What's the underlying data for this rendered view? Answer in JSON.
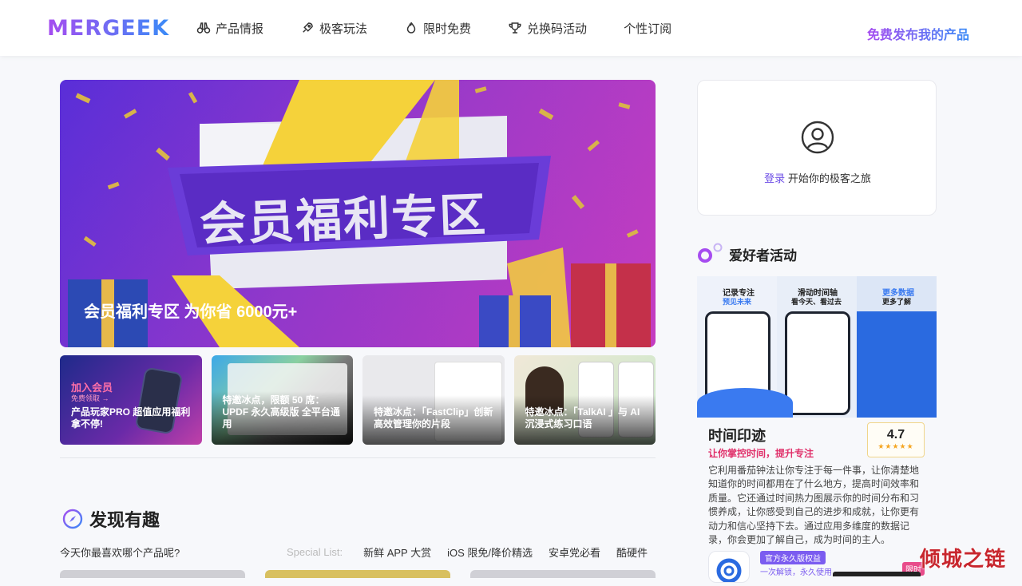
{
  "header": {
    "logo": "MERGEEK",
    "nav": [
      {
        "label": "产品情报",
        "icon": "binoculars-icon"
      },
      {
        "label": "极客玩法",
        "icon": "rocket-icon"
      },
      {
        "label": "限时免费",
        "icon": "flame-icon"
      },
      {
        "label": "兑换码活动",
        "icon": "trophy-icon"
      },
      {
        "label": "个性订阅",
        "icon": ""
      }
    ],
    "publish_label": "免费发布我的产品"
  },
  "hero": {
    "banner_text": "会员福利专区",
    "caption": "会员福利专区 为你省 6000元+"
  },
  "cards": [
    {
      "badge": "加入会员",
      "badge_sub": "免费领取 →",
      "text": "产品玩家PRO 超值应用福利拿不停!"
    },
    {
      "badge": "",
      "badge_sub": "",
      "text": "特邀冰点，限额 50 席：UPDF 永久高级版 全平台通用"
    },
    {
      "badge": "",
      "badge_sub": "",
      "text": "特邀冰点：「FastClip」创新高效管理你的片段"
    },
    {
      "badge": "",
      "badge_sub": "",
      "text": "特邀冰点：「TalkAI 」与 AI 沉浸式练习口语"
    }
  ],
  "discover": {
    "title": "发现有趣",
    "question": "今天你最喜欢哪个产品呢?",
    "special_label": "Special List:",
    "special_links": [
      "新鲜 APP 大赏",
      "iOS 限免/降价精选",
      "安卓党必看",
      "酷硬件"
    ]
  },
  "login": {
    "login_link": "登录",
    "text": "开始你的极客之旅"
  },
  "activity": {
    "title": "爱好者活动",
    "app_name": "时间印迹",
    "slogan": "让你掌控时间，提升专注",
    "rating": "4.7",
    "stars": "★★★★★",
    "description": "它利用番茄钟法让你专注于每一件事，让你清楚地知道你的时间都用在了什么地方，提高时间效率和质量。它还通过时间热力图展示你的时间分布和习惯养成，让你感受到自己的进步和成就，让你更有动力和信心坚持下去。通过应用多维度的数据记录，你会更加了解自己，成为时间的主人。",
    "tag1": "官方永久版权益",
    "tag2": "一次解锁，永久使用",
    "tag3": "限时",
    "img_captions": [
      "记录专注",
      "预见未来",
      "滑动时间轴",
      "看今天、看过去",
      "更多数据",
      "更多了解"
    ]
  },
  "watermark": "倾城之链",
  "colors": {
    "brand_purple": "#a64cf0",
    "brand_blue": "#3a8bf7",
    "link_purple": "#6c4de6",
    "slogan_pink": "#e0306a"
  }
}
